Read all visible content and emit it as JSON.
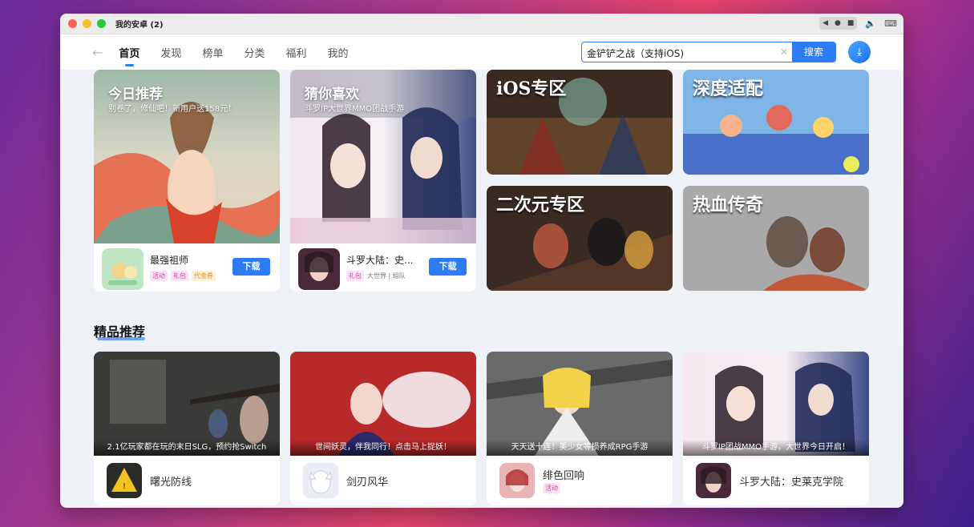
{
  "window": {
    "title": "我的安卓 (2)"
  },
  "nav": {
    "tabs": [
      {
        "label": "首页",
        "active": true
      },
      {
        "label": "发现",
        "active": false
      },
      {
        "label": "榜单",
        "active": false
      },
      {
        "label": "分类",
        "active": false
      },
      {
        "label": "福利",
        "active": false
      },
      {
        "label": "我的",
        "active": false
      }
    ],
    "search_value": "金铲铲之战（支持iOS)",
    "search_button": "搜索"
  },
  "featured": {
    "today": {
      "title": "今日推荐",
      "subtitle": "别卷了，修仙吧！新用户送158元！",
      "app_name": "最强祖师",
      "tags": [
        "活动",
        "礼包",
        "代金券"
      ],
      "download_label": "下载"
    },
    "guess": {
      "title": "猜你喜欢",
      "subtitle": "斗罗IP大世界MMO团战手游",
      "app_name": "斗罗大陆：史...",
      "tag": "礼包",
      "meta": "大世界 | 组队",
      "download_label": "下载"
    }
  },
  "zones": [
    {
      "label": "iOS专区"
    },
    {
      "label": "深度适配"
    },
    {
      "label": "二次元专区"
    },
    {
      "label": "热血传奇"
    }
  ],
  "recommend": {
    "section_title": "精品推荐",
    "items": [
      {
        "caption": "2.1亿玩家都在玩的末日SLG，预约抢Switch",
        "name": "曙光防线",
        "tag": ""
      },
      {
        "caption": "世间妖灵，伴我同行！点击马上捉妖！",
        "name": "剑刃风华",
        "tag": ""
      },
      {
        "caption": "天天送十连！美少女等损养成RPG手游",
        "name": "绯色回响",
        "tag": "活动"
      },
      {
        "caption": "斗罗IP团战MMO手游，大世界今日开启！",
        "name": "斗罗大陆：史莱克学院",
        "tag": ""
      }
    ]
  },
  "colors": {
    "accent": "#2e7bf6",
    "tag_pink": "#e23aa6",
    "tag_orange": "#e48a12"
  }
}
